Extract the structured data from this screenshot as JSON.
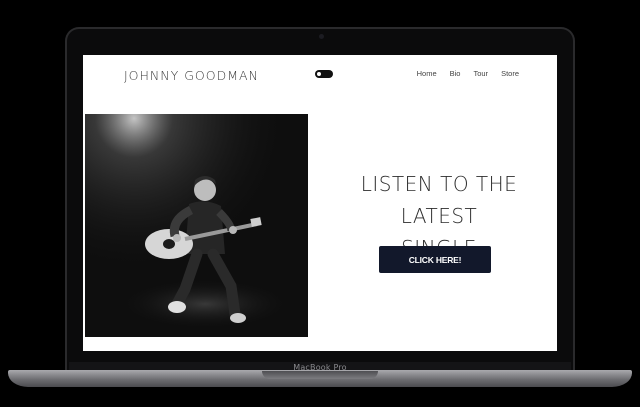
{
  "site": {
    "brand": "JOHNNY GOODMAN",
    "nav": [
      "Home",
      "Bio",
      "Tour",
      "Store"
    ],
    "hero": {
      "headline_line1": "LISTEN TO THE LATEST",
      "headline_line2": "SINGLE",
      "cta_label": "CLICK HERE!"
    }
  },
  "device": {
    "model_label": "MacBook Pro"
  },
  "colors": {
    "cta_bg": "#12182b",
    "page_bg": "#ffffff",
    "photo_bg": "#0e0e0e"
  }
}
